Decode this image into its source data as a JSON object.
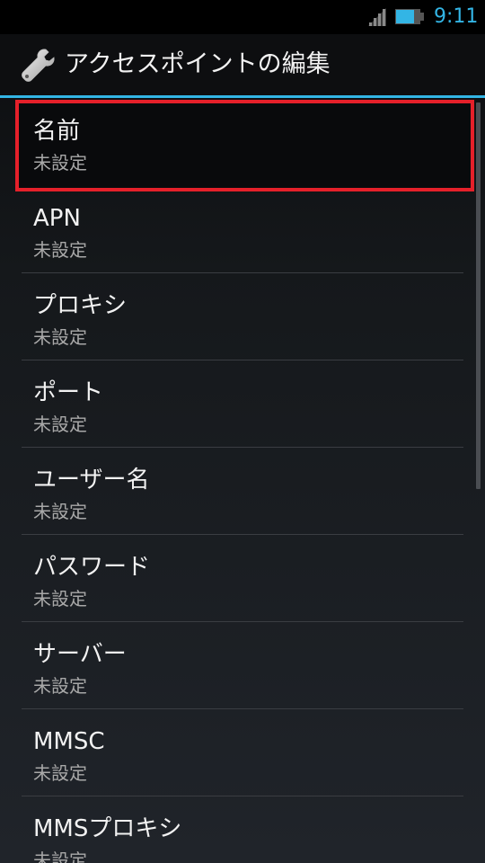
{
  "status_bar": {
    "time": "9:11",
    "signal_icon": "signal-icon",
    "battery_icon": "battery-icon",
    "accent_color": "#33b5e5"
  },
  "action_bar": {
    "title": "アクセスポイントの編集",
    "icon": "wrench-icon"
  },
  "preferences": [
    {
      "title": "名前",
      "summary": "未設定",
      "highlighted": true
    },
    {
      "title": "APN",
      "summary": "未設定"
    },
    {
      "title": "プロキシ",
      "summary": "未設定"
    },
    {
      "title": "ポート",
      "summary": "未設定"
    },
    {
      "title": "ユーザー名",
      "summary": "未設定"
    },
    {
      "title": "パスワード",
      "summary": "未設定"
    },
    {
      "title": "サーバー",
      "summary": "未設定"
    },
    {
      "title": "MMSC",
      "summary": "未設定"
    },
    {
      "title": "MMSプロキシ",
      "summary": "未設定"
    }
  ],
  "colors": {
    "highlight_border": "#e5202a",
    "divider": "#3a3d42"
  }
}
